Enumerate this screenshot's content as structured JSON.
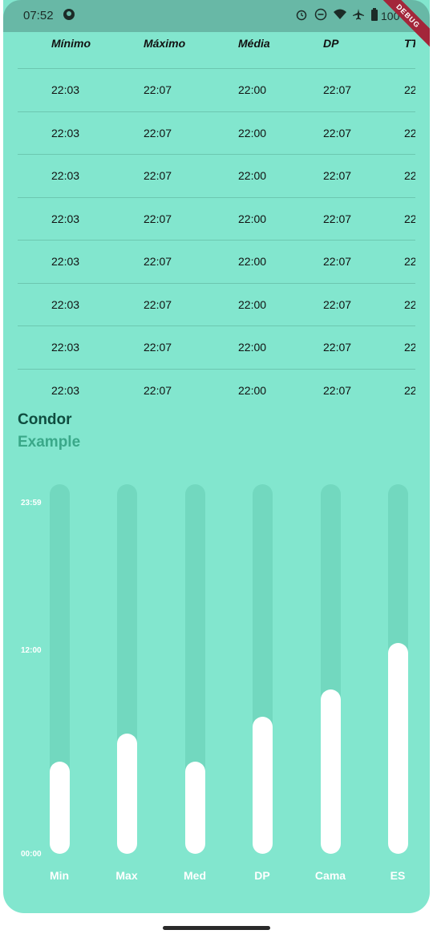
{
  "status_bar": {
    "time": "07:52",
    "battery": "100"
  },
  "debug_banner": "DEBUG",
  "table": {
    "headers": [
      "Mínimo",
      "Máximo",
      "Média",
      "DP",
      "TT"
    ],
    "rows": [
      [
        "22:03",
        "22:07",
        "22:00",
        "22:07",
        "22"
      ],
      [
        "22:03",
        "22:07",
        "22:00",
        "22:07",
        "22"
      ],
      [
        "22:03",
        "22:07",
        "22:00",
        "22:07",
        "22"
      ],
      [
        "22:03",
        "22:07",
        "22:00",
        "22:07",
        "22"
      ],
      [
        "22:03",
        "22:07",
        "22:00",
        "22:07",
        "22"
      ],
      [
        "22:03",
        "22:07",
        "22:00",
        "22:07",
        "22"
      ],
      [
        "22:03",
        "22:07",
        "22:00",
        "22:07",
        "22"
      ],
      [
        "22:03",
        "22:07",
        "22:00",
        "22:07",
        "22"
      ]
    ]
  },
  "chart_data": {
    "type": "bar",
    "title": "Condor",
    "subtitle": "Example",
    "categories": [
      "Min",
      "Max",
      "Med",
      "DP",
      "Cama",
      "ES"
    ],
    "values_fraction_of_day": [
      0.25,
      0.325,
      0.25,
      0.37,
      0.445,
      0.57
    ],
    "yticks": [
      "00:00",
      "12:00",
      "23:59"
    ],
    "colors": {
      "background": "#82e6ce",
      "track": "#72d8bf",
      "bar": "#ffffff"
    }
  }
}
